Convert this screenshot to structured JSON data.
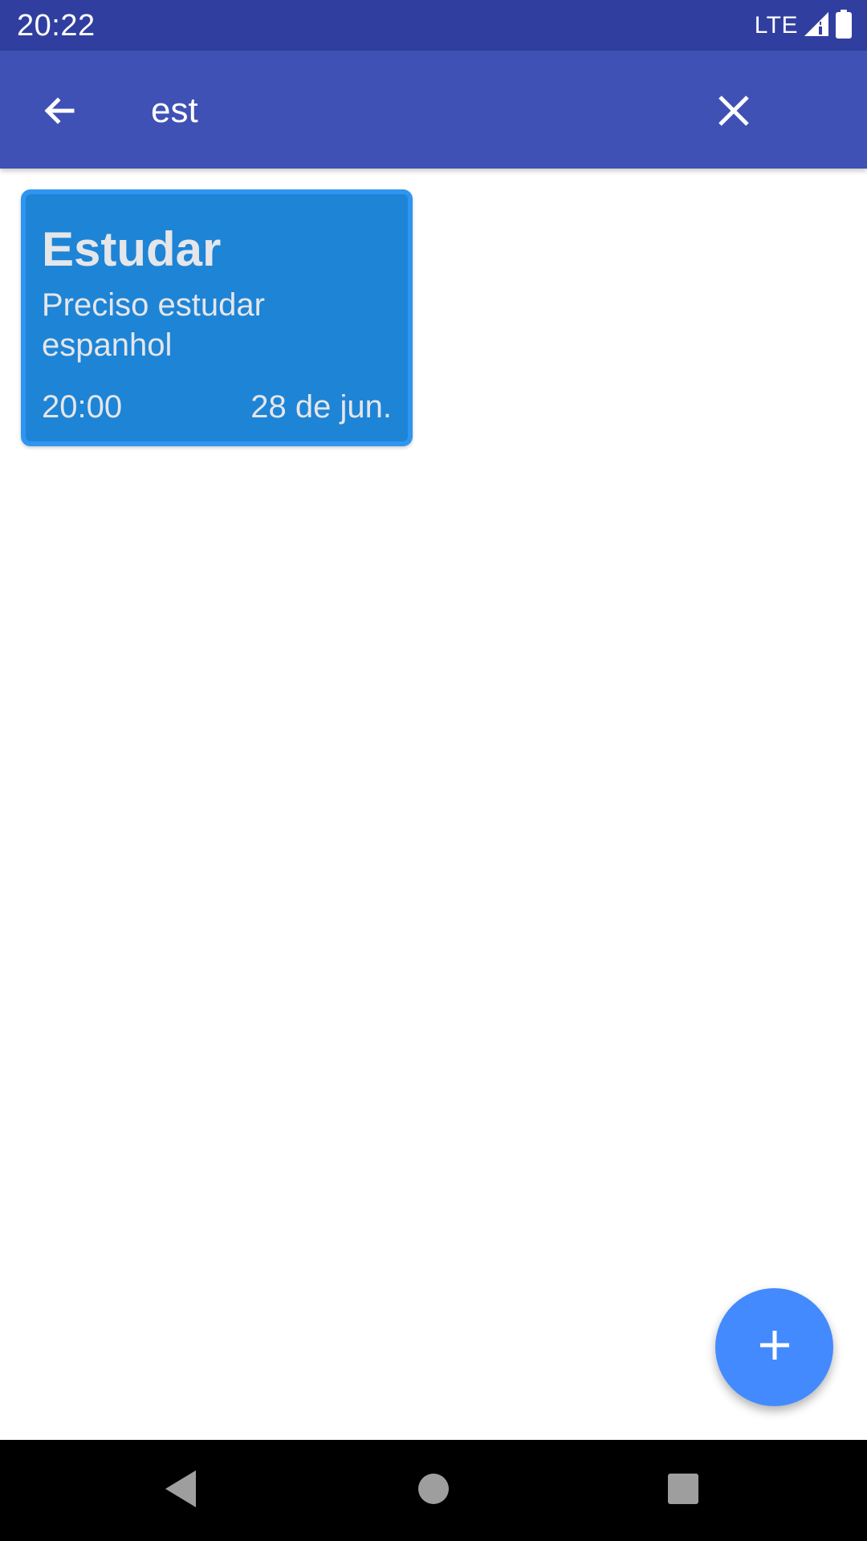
{
  "status_bar": {
    "time": "20:22",
    "network": "LTE",
    "icons": [
      "signal-icon",
      "battery-icon"
    ]
  },
  "toolbar": {
    "back_icon": "arrow-back-icon",
    "search_value": "est",
    "search_placeholder": "",
    "clear_icon": "close-icon",
    "color": "#3F51B5"
  },
  "notes": [
    {
      "title": "Estudar",
      "body": "Preciso estudar espanhol",
      "time": "20:00",
      "date": "28 de jun.",
      "color": "#1E84D6"
    }
  ],
  "fab": {
    "icon": "plus-icon",
    "color": "#448AFF"
  },
  "nav_bar": {
    "icons": [
      "back-triangle-icon",
      "home-circle-icon",
      "recents-square-icon"
    ]
  },
  "colors": {
    "status_bar": "#303F9F",
    "accent": "#448AFF"
  }
}
